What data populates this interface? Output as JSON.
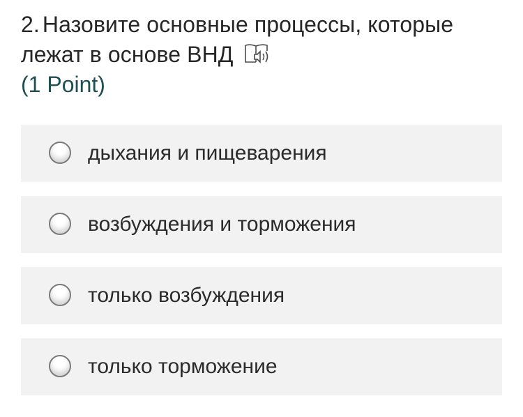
{
  "question": {
    "number": "2.",
    "text": "Назовите основные процессы, которые лежат в основе ВНД",
    "points": "(1 Point)",
    "reader_icon": "immersive-reader-icon"
  },
  "options": [
    {
      "label": "дыхания и пищеварения",
      "selected": false
    },
    {
      "label": "возбуждения и торможения",
      "selected": false
    },
    {
      "label": "только возбуждения",
      "selected": false
    },
    {
      "label": "только торможение",
      "selected": false
    }
  ],
  "colors": {
    "option_background": "#f2f2f2",
    "points_text": "#1f4f50",
    "title_text": "#262626"
  }
}
